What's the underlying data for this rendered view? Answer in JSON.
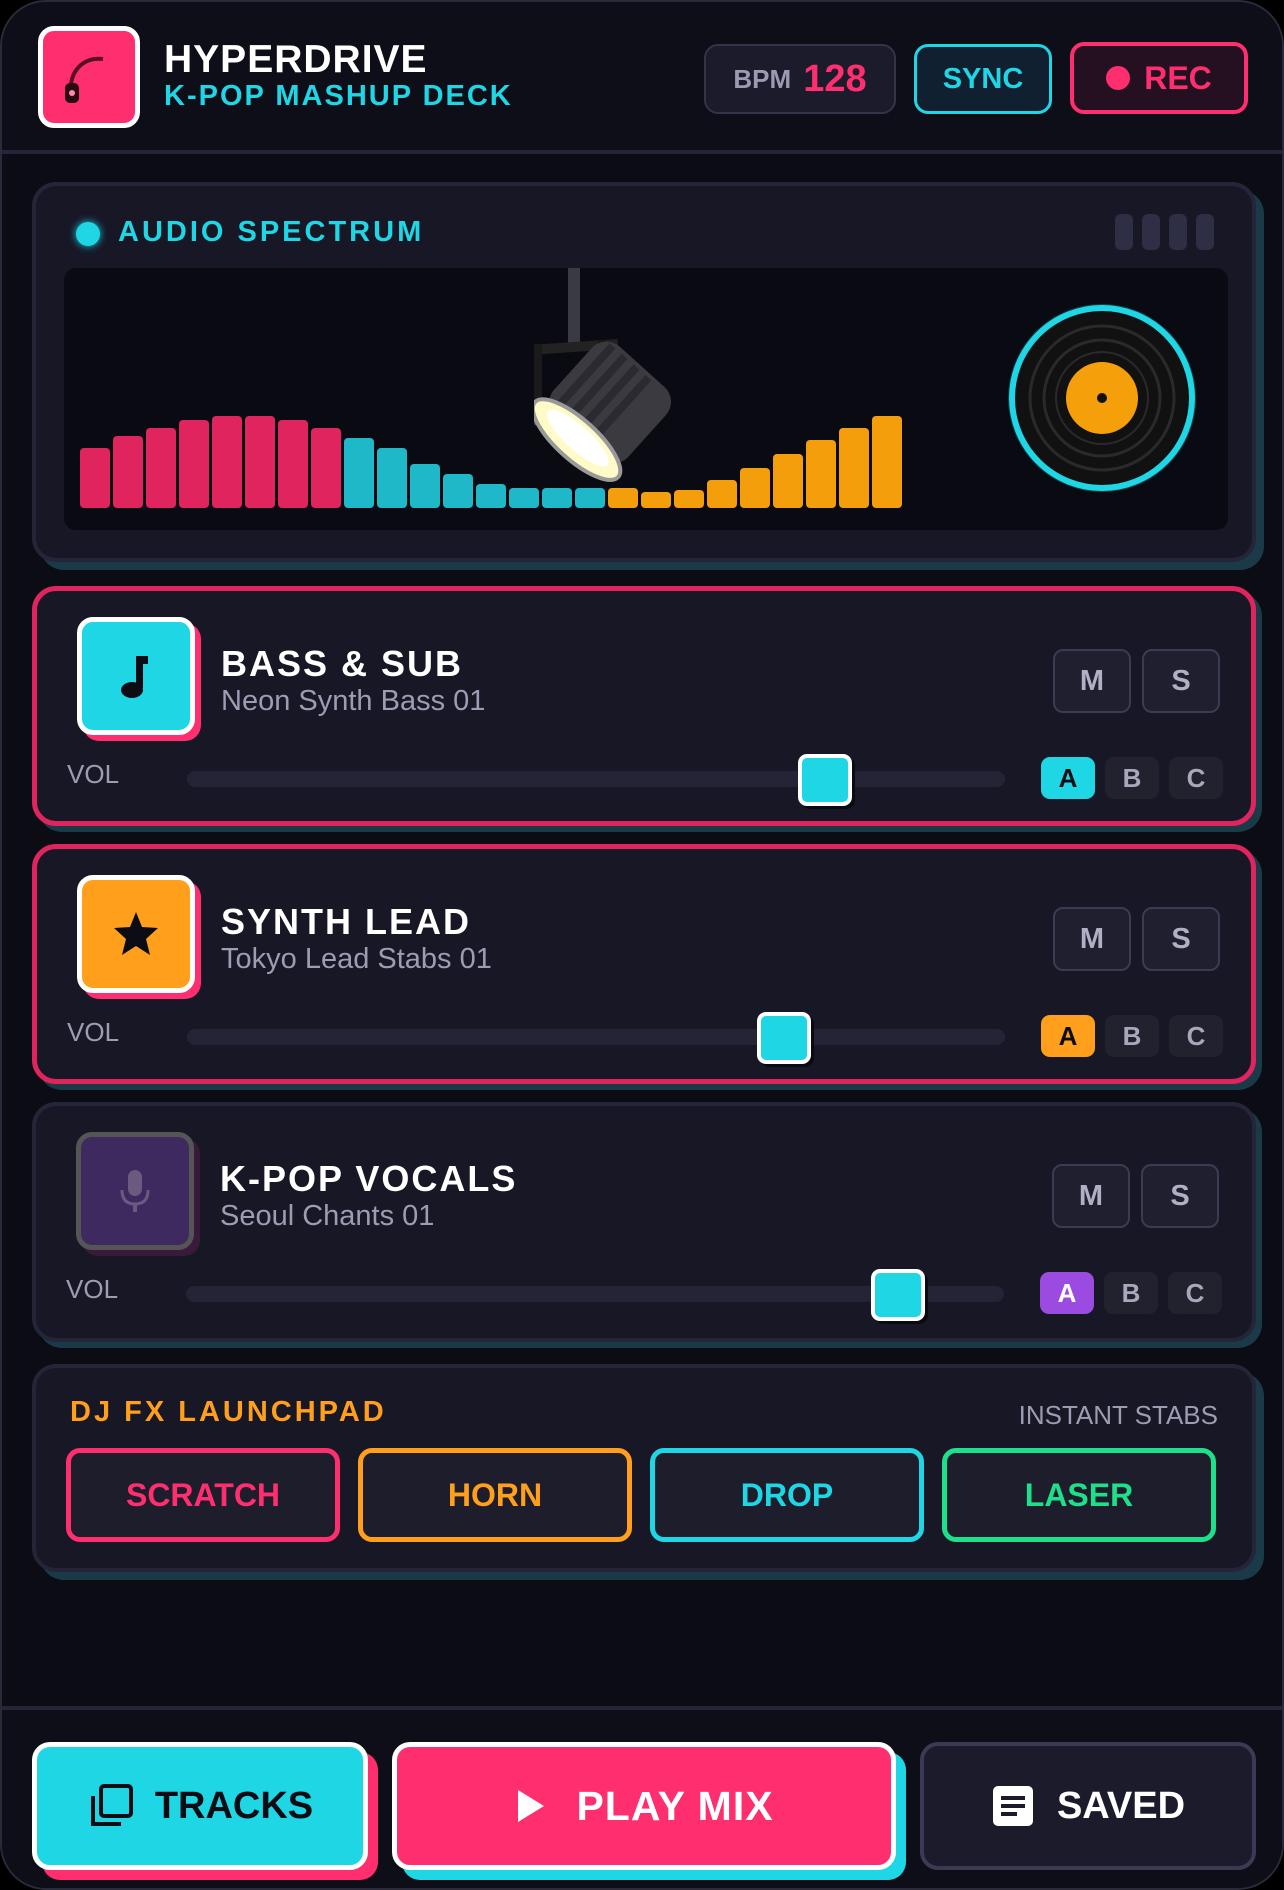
{
  "header": {
    "title": "HYPERDRIVE",
    "subtitle": "K-POP MASHUP DECK",
    "bpm_label": "BPM",
    "bpm_value": "128",
    "sync_label": "SYNC",
    "rec_label": "REC"
  },
  "spectrum": {
    "title": "AUDIO SPECTRUM",
    "levels": [
      0.3,
      0.36,
      0.4,
      0.44,
      0.46,
      0.46,
      0.44,
      0.4,
      0.35,
      0.3,
      0.22,
      0.17,
      0.12,
      0.1,
      0.1,
      0.1,
      0.1,
      0.08,
      0.09,
      0.14,
      0.2,
      0.27,
      0.34,
      0.4,
      0.46
    ],
    "colors": [
      "#e0245e",
      "#e0245e",
      "#e0245e",
      "#e0245e",
      "#e0245e",
      "#e0245e",
      "#e0245e",
      "#e0245e",
      "#1fb8c8",
      "#1fb8c8",
      "#1fb8c8",
      "#1fb8c8",
      "#1fb8c8",
      "#1fb8c8",
      "#1fb8c8",
      "#1fb8c8",
      "#f59e0b",
      "#f59e0b",
      "#f59e0b",
      "#f59e0b",
      "#f59e0b",
      "#f59e0b",
      "#f59e0b",
      "#f59e0b",
      "#f59e0b"
    ]
  },
  "tracks": [
    {
      "title": "BASS & SUB",
      "subtitle": "Neon Synth Bass 01",
      "icon": "music-note-icon",
      "icon_color": "#1fd6e5",
      "mute_label": "M",
      "solo_label": "S",
      "vol_label": "VOL",
      "volume": 0.78,
      "bank_labels": [
        "A",
        "B",
        "C"
      ],
      "active_bank_color": "#1fd6e5",
      "active": true
    },
    {
      "title": "SYNTH LEAD",
      "subtitle": "Tokyo Lead Stabs 01",
      "icon": "star-icon",
      "icon_color": "#ff9f1c",
      "mute_label": "M",
      "solo_label": "S",
      "vol_label": "VOL",
      "volume": 0.73,
      "bank_labels": [
        "A",
        "B",
        "C"
      ],
      "active_bank_color": "#ff9f1c",
      "active": true
    },
    {
      "title": "K-POP VOCALS",
      "subtitle": "Seoul Chants 01",
      "icon": "microphone-icon",
      "icon_color": "#3e2a5e",
      "mute_label": "M",
      "solo_label": "S",
      "vol_label": "VOL",
      "volume": 0.87,
      "bank_labels": [
        "A",
        "B",
        "C"
      ],
      "active_bank_color": "#9b4be0",
      "active": false
    }
  ],
  "fx": {
    "title": "DJ FX LAUNCHPAD",
    "subtitle": "INSTANT STABS",
    "buttons": [
      {
        "label": "SCRATCH",
        "color": "#ff2e6e"
      },
      {
        "label": "HORN",
        "color": "#ff9f1c"
      },
      {
        "label": "DROP",
        "color": "#1fd6e5"
      },
      {
        "label": "LASER",
        "color": "#1fe08a"
      }
    ]
  },
  "bottom": {
    "tracks_label": "TRACKS",
    "play_label": "PLAY MIX",
    "saved_label": "SAVED"
  }
}
